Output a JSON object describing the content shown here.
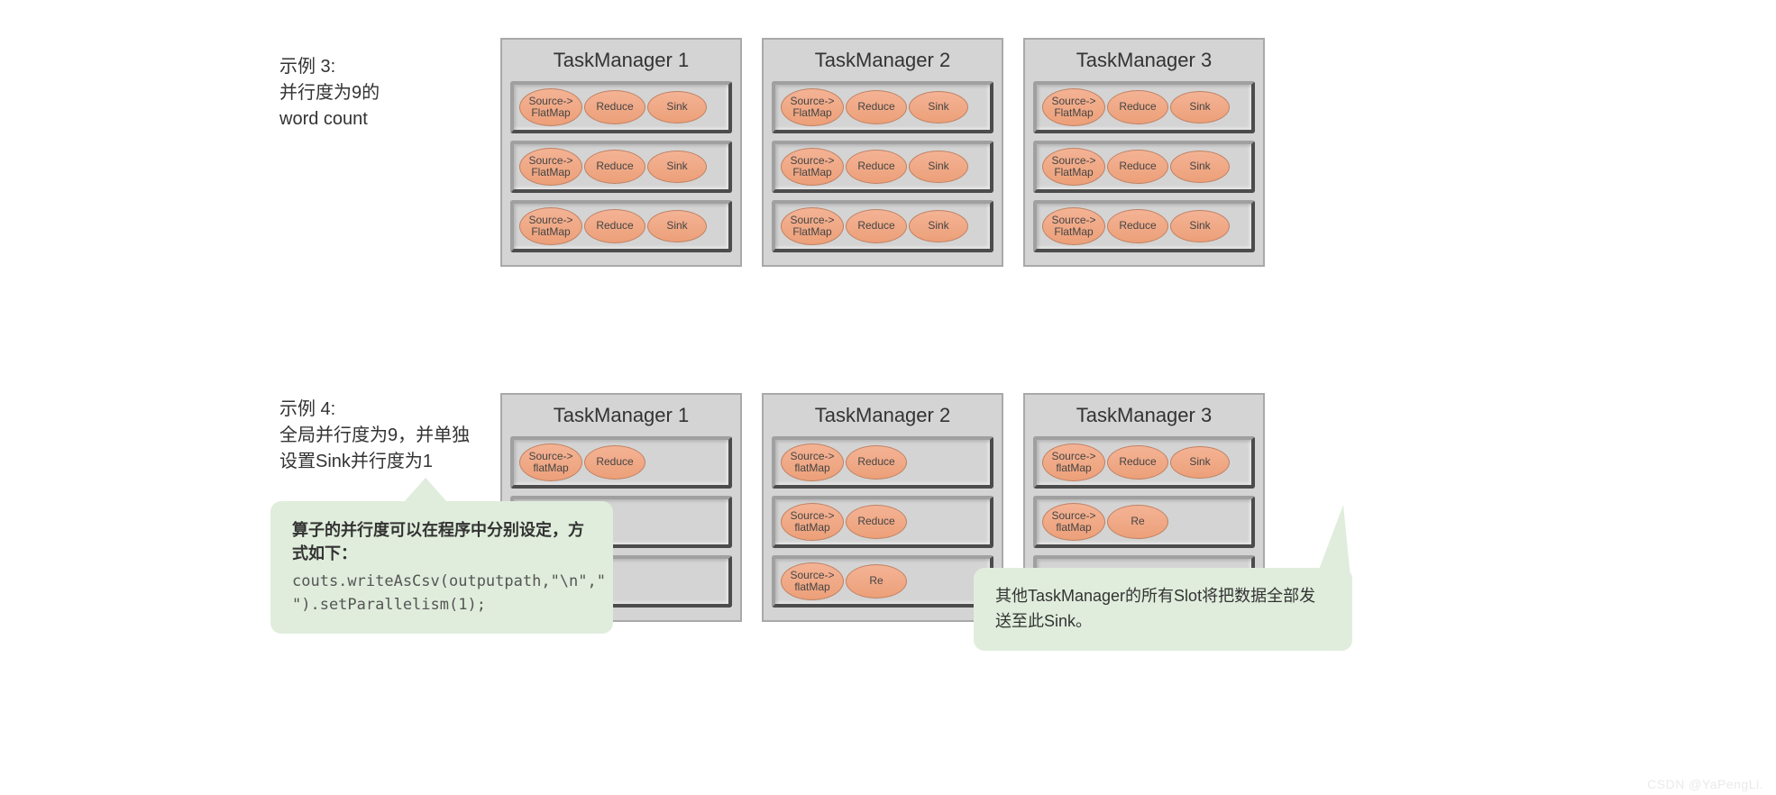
{
  "example3": {
    "label": "示例 3:\n并行度为9的\nword count",
    "managers": [
      {
        "title": "TaskManager 1",
        "slots": [
          {
            "ops": [
              {
                "t": "src",
                "l": "Source->\nFlatMap"
              },
              {
                "t": "reduce",
                "l": "Reduce"
              },
              {
                "t": "sink",
                "l": "Sink"
              }
            ]
          },
          {
            "ops": [
              {
                "t": "src",
                "l": "Source->\nFlatMap"
              },
              {
                "t": "reduce",
                "l": "Reduce"
              },
              {
                "t": "sink",
                "l": "Sink"
              }
            ]
          },
          {
            "ops": [
              {
                "t": "src",
                "l": "Source->\nFlatMap"
              },
              {
                "t": "reduce",
                "l": "Reduce"
              },
              {
                "t": "sink",
                "l": "Sink"
              }
            ]
          }
        ]
      },
      {
        "title": "TaskManager 2",
        "slots": [
          {
            "ops": [
              {
                "t": "src",
                "l": "Source->\nFlatMap"
              },
              {
                "t": "reduce",
                "l": "Reduce"
              },
              {
                "t": "sink",
                "l": "Sink"
              }
            ]
          },
          {
            "ops": [
              {
                "t": "src",
                "l": "Source->\nFlatMap"
              },
              {
                "t": "reduce",
                "l": "Reduce"
              },
              {
                "t": "sink",
                "l": "Sink"
              }
            ]
          },
          {
            "ops": [
              {
                "t": "src",
                "l": "Source->\nFlatMap"
              },
              {
                "t": "reduce",
                "l": "Reduce"
              },
              {
                "t": "sink",
                "l": "Sink"
              }
            ]
          }
        ]
      },
      {
        "title": "TaskManager 3",
        "slots": [
          {
            "ops": [
              {
                "t": "src",
                "l": "Source->\nFlatMap"
              },
              {
                "t": "reduce",
                "l": "Reduce"
              },
              {
                "t": "sink",
                "l": "Sink"
              }
            ]
          },
          {
            "ops": [
              {
                "t": "src",
                "l": "Source->\nFlatMap"
              },
              {
                "t": "reduce",
                "l": "Reduce"
              },
              {
                "t": "sink",
                "l": "Sink"
              }
            ]
          },
          {
            "ops": [
              {
                "t": "src",
                "l": "Source->\nFlatMap"
              },
              {
                "t": "reduce",
                "l": "Reduce"
              },
              {
                "t": "sink",
                "l": "Sink"
              }
            ]
          }
        ]
      }
    ]
  },
  "example4": {
    "label": "示例 4:\n全局并行度为9，并单独\n设置Sink并行度为1",
    "managers": [
      {
        "title": "TaskManager 1",
        "slots": [
          {
            "ops": [
              {
                "t": "src",
                "l": "Source->\nflatMap"
              },
              {
                "t": "reduce",
                "l": "Reduce"
              }
            ]
          },
          {
            "ops": []
          },
          {
            "ops": []
          }
        ]
      },
      {
        "title": "TaskManager 2",
        "slots": [
          {
            "ops": [
              {
                "t": "src",
                "l": "Source->\nflatMap"
              },
              {
                "t": "reduce",
                "l": "Reduce"
              }
            ]
          },
          {
            "ops": [
              {
                "t": "src",
                "l": "Source->\nflatMap"
              },
              {
                "t": "reduce",
                "l": "Reduce"
              }
            ]
          },
          {
            "ops": [
              {
                "t": "src",
                "l": "Source->\nflatMap"
              },
              {
                "t": "reduce",
                "l": "Re"
              }
            ]
          }
        ]
      },
      {
        "title": "TaskManager 3",
        "slots": [
          {
            "ops": [
              {
                "t": "src",
                "l": "Source->\nflatMap"
              },
              {
                "t": "reduce",
                "l": "Reduce"
              },
              {
                "t": "sink",
                "l": "Sink"
              }
            ]
          },
          {
            "ops": [
              {
                "t": "src",
                "l": "Source->\nflatMap"
              },
              {
                "t": "reduce",
                "l": "Re"
              }
            ]
          },
          {
            "ops": []
          }
        ]
      }
    ]
  },
  "callout1": {
    "title": "算子的并行度可以在程序中分别设定，方式如下：",
    "code": "couts.writeAsCsv(outputpath,\"\\n\",\" \").setParallelism(1);"
  },
  "callout2": {
    "text": "其他TaskManager的所有Slot将把数据全部发送至此Sink。"
  },
  "watermark": "CSDN @YaPengLi."
}
